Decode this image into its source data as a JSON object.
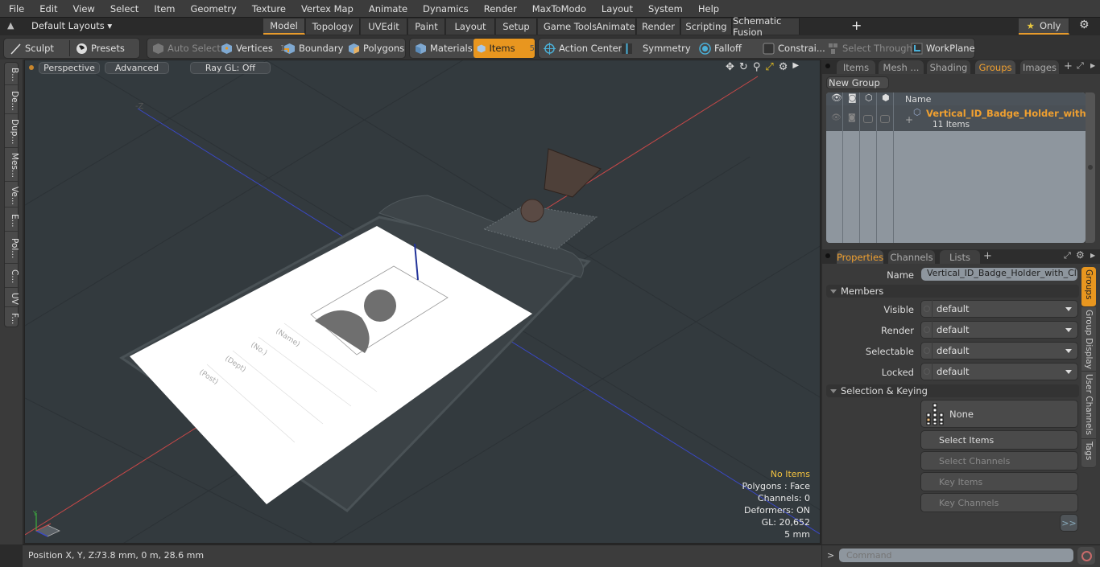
{
  "menu": [
    "File",
    "Edit",
    "View",
    "Select",
    "Item",
    "Geometry",
    "Texture",
    "Vertex Map",
    "Animate",
    "Dynamics",
    "Render",
    "MaxToModo",
    "Layout",
    "System",
    "Help"
  ],
  "layouts": {
    "selector_label": "Default Layouts",
    "tabs": [
      "Model",
      "Topology",
      "UVEdit",
      "Paint",
      "Layout",
      "Setup",
      "Game Tools",
      "Animate",
      "Render",
      "Scripting",
      "Schematic Fusion"
    ],
    "active_tab": "Model",
    "add_tab": "+",
    "only_label": "Only"
  },
  "toolbar": {
    "sculpt": "Sculpt",
    "presets": "Presets",
    "auto_select": "Auto Select",
    "vertices": "Vertices",
    "vertices_count": "1",
    "boundary": "Boundary",
    "polygons": "Polygons",
    "materials": "Materials",
    "items": "Items",
    "items_count": "5",
    "action_center": "Action Center",
    "symmetry": "Symmetry",
    "falloff": "Falloff",
    "constraints": "Constrai...",
    "select_through": "Select Through",
    "workplane": "WorkPlane"
  },
  "left_tabs": [
    "B...",
    "De...",
    "Dup...",
    "Mes...",
    "Ve...",
    "E...",
    "Pol...",
    "C...",
    "UV",
    "F..."
  ],
  "viewport": {
    "view_mode": "Perspective",
    "shading": "Advanced",
    "raygl": "Ray GL: Off",
    "axis_neg_z": "-Z",
    "badge_fields": [
      "(Name)",
      "(No.)",
      "(Dept)",
      "(Post)"
    ],
    "hud": {
      "selection": "No Items",
      "mode": "Polygons : Face",
      "channels": "Channels: 0",
      "deformers": "Deformers: ON",
      "gl": "GL: 20,652",
      "grid": "5 mm"
    }
  },
  "status": {
    "position_label": "Position X, Y, Z:",
    "position_value": "73.8 mm, 0 m, 28.6 mm"
  },
  "top_panel": {
    "tabs": [
      "Items",
      "Mesh ...",
      "Shading",
      "Groups",
      "Images"
    ],
    "active_tab": "Groups",
    "new_group": "New Group",
    "column_name": "Name",
    "groups": [
      {
        "name": "Vertical_ID_Badge_Holder_with ...",
        "sub": "11 Items"
      }
    ]
  },
  "properties_panel": {
    "tabs": [
      "Properties",
      "Channels",
      "Lists"
    ],
    "active_tab": "Properties",
    "name_label": "Name",
    "name_value": "Vertical_ID_Badge_Holder_with_Clip (",
    "members_section": "Members",
    "fields": [
      {
        "label": "Visible",
        "value": "default"
      },
      {
        "label": "Render",
        "value": "default"
      },
      {
        "label": "Selectable",
        "value": "default"
      },
      {
        "label": "Locked",
        "value": "default"
      }
    ],
    "selection_section": "Selection & Keying",
    "none_label": "None",
    "select_items": "Select Items",
    "select_channels": "Select Channels",
    "key_items": "Key Items",
    "key_channels": "Key Channels",
    "more": ">>",
    "side_tabs": [
      "Groups",
      "Group Display",
      "User Channels",
      "Tags"
    ],
    "active_side_tab": "Groups"
  },
  "command": {
    "prompt": ">",
    "placeholder": "Command"
  },
  "colors": {
    "accent": "#e8961f",
    "group_name": "#f0a030",
    "hud_highlight": "#f0c040"
  }
}
